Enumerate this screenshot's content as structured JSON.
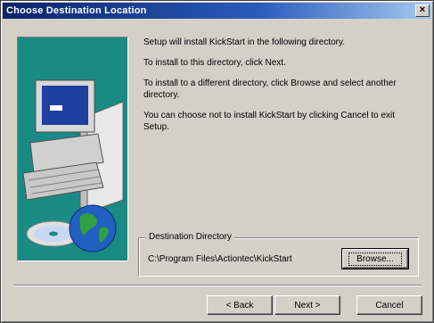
{
  "window": {
    "title": "Choose Destination Location",
    "close_glyph": "×"
  },
  "colors": {
    "title_bar_start": "#0a246a",
    "title_bar_end": "#a6caf0",
    "dialog_face": "#d4d0c8",
    "art_background": "#1a8a84"
  },
  "art": {
    "icons": [
      "computer-icon",
      "cd-disc-icon",
      "globe-icon"
    ]
  },
  "content": {
    "para1": "Setup will install KickStart in the following directory.",
    "para2": "To install to this directory, click Next.",
    "para3": "To install to a different directory, click Browse and select another directory.",
    "para4": "You can choose not to install KickStart by clicking Cancel to exit Setup."
  },
  "destination": {
    "group_label": "Destination Directory",
    "path": "C:\\Program Files\\Actiontec\\KickStart",
    "browse_label": "Browse..."
  },
  "buttons": {
    "back_label": "< Back",
    "next_label": "Next >",
    "cancel_label": "Cancel"
  }
}
